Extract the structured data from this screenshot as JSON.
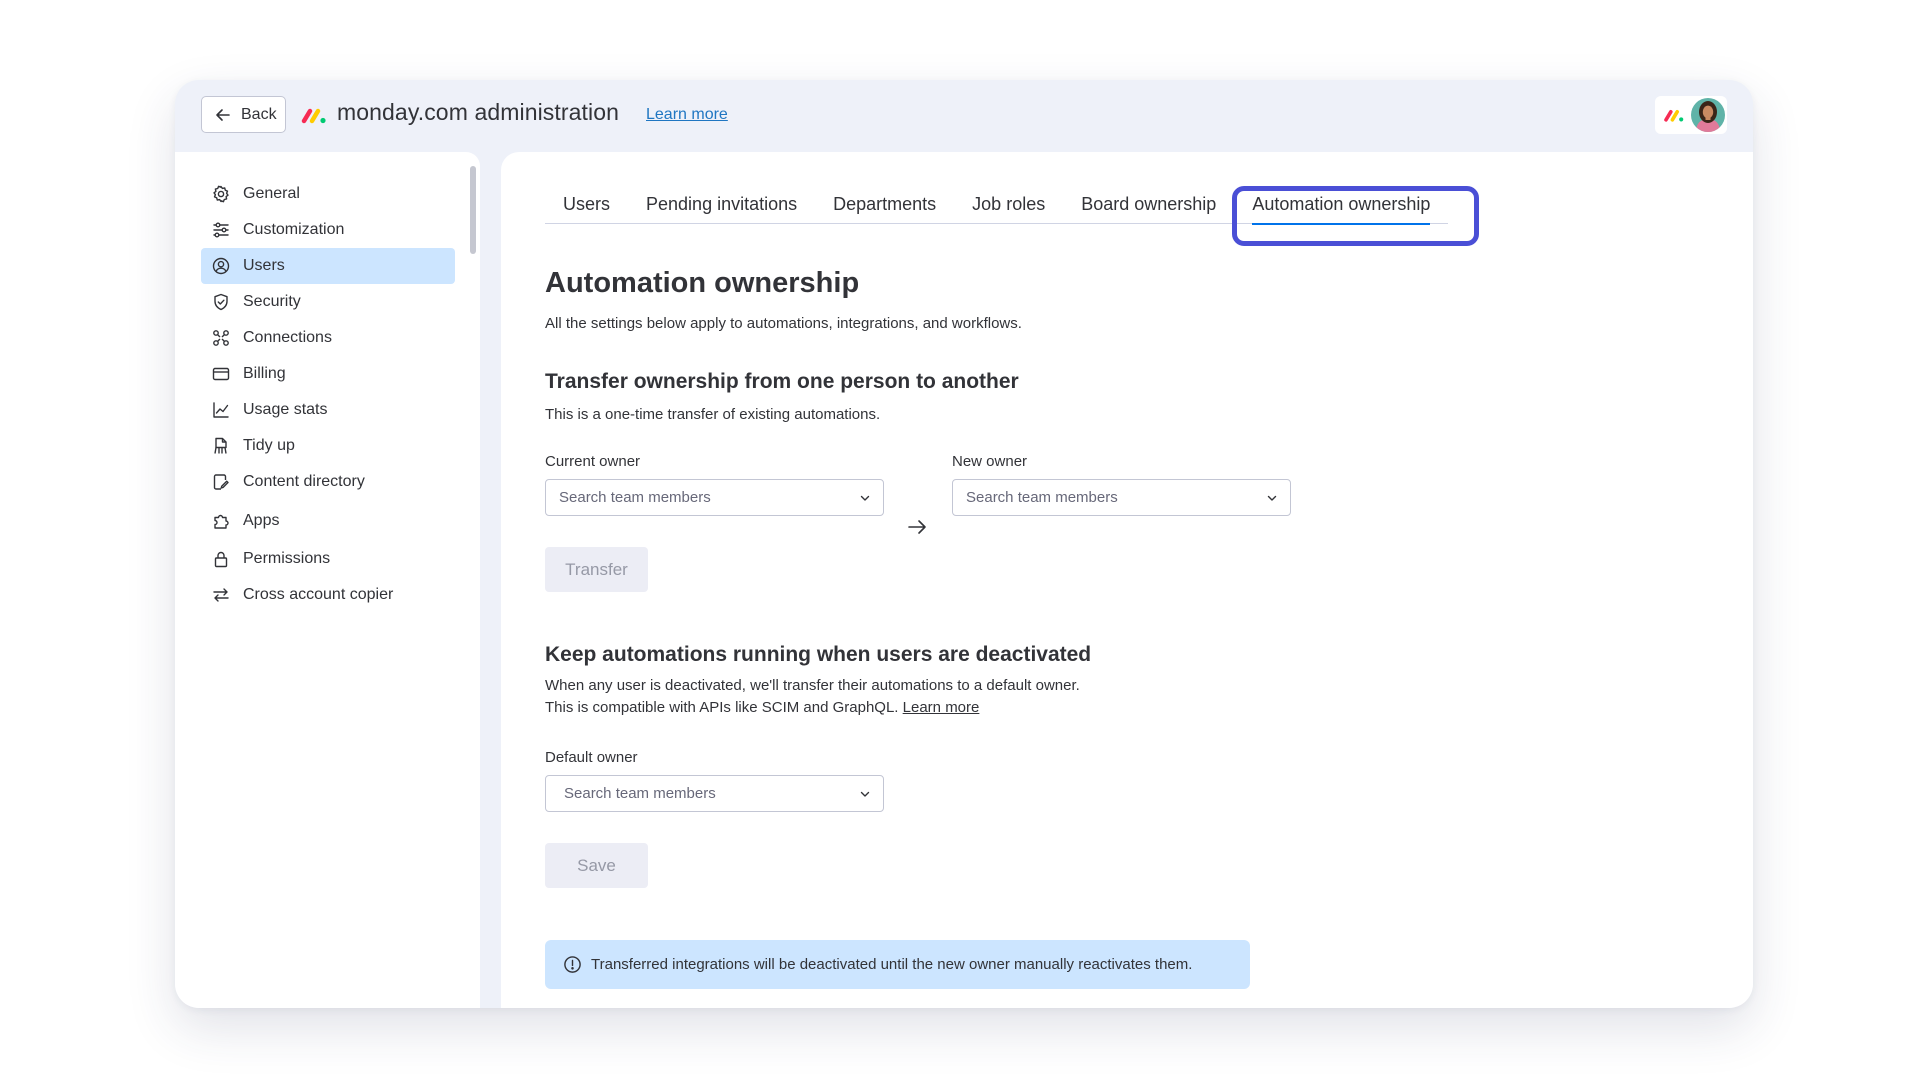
{
  "header": {
    "back_label": "Back",
    "app_title": "monday.com administration",
    "learn_more": "Learn more"
  },
  "brand_colors": {
    "red": "#f62b54",
    "yellow": "#ffcc00",
    "green": "#00ca72"
  },
  "sidebar": {
    "items": [
      {
        "label": "General",
        "icon": "gear-icon"
      },
      {
        "label": "Customization",
        "icon": "sliders-icon"
      },
      {
        "label": "Users",
        "icon": "user-circle-icon",
        "active": true
      },
      {
        "label": "Security",
        "icon": "shield-icon"
      },
      {
        "label": "Connections",
        "icon": "connections-icon"
      },
      {
        "label": "Billing",
        "icon": "credit-card-icon"
      },
      {
        "label": "Usage stats",
        "icon": "chart-line-icon"
      },
      {
        "label": "Tidy up",
        "icon": "broom-icon"
      },
      {
        "label": "Content directory",
        "icon": "document-icon"
      },
      {
        "label": "Apps",
        "icon": "puzzle-icon"
      },
      {
        "label": "Permissions",
        "icon": "lock-icon"
      },
      {
        "label": "Cross account copier",
        "icon": "swap-icon"
      }
    ]
  },
  "tabs": [
    {
      "label": "Users"
    },
    {
      "label": "Pending invitations"
    },
    {
      "label": "Departments"
    },
    {
      "label": "Job roles"
    },
    {
      "label": "Board ownership"
    },
    {
      "label": "Automation ownership",
      "active": true
    }
  ],
  "page": {
    "title": "Automation ownership",
    "subtitle": "All the settings below apply to automations, integrations, and workflows."
  },
  "transfer": {
    "title": "Transfer ownership from one person to another",
    "description": "This is a one-time transfer of existing automations.",
    "current_owner_label": "Current owner",
    "current_owner_placeholder": "Search team members",
    "new_owner_label": "New owner",
    "new_owner_placeholder": "Search team members",
    "button": "Transfer"
  },
  "deactivated": {
    "title": "Keep automations running when users are deactivated",
    "line1": "When any user is deactivated, we'll transfer their automations to a default owner.",
    "line2": "This is compatible with APIs like SCIM and GraphQL.",
    "learn_more": "Learn more",
    "default_owner_label": "Default owner",
    "default_owner_placeholder": "Search team members",
    "button": "Save"
  },
  "notice": {
    "text": "Transferred integrations will be deactivated until the new owner manually reactivates them.",
    "icon": "info-circle-icon"
  },
  "accent": {
    "highlight": "#4a4fd6",
    "active_bg": "#cce5ff",
    "link": "#1f76c2"
  }
}
